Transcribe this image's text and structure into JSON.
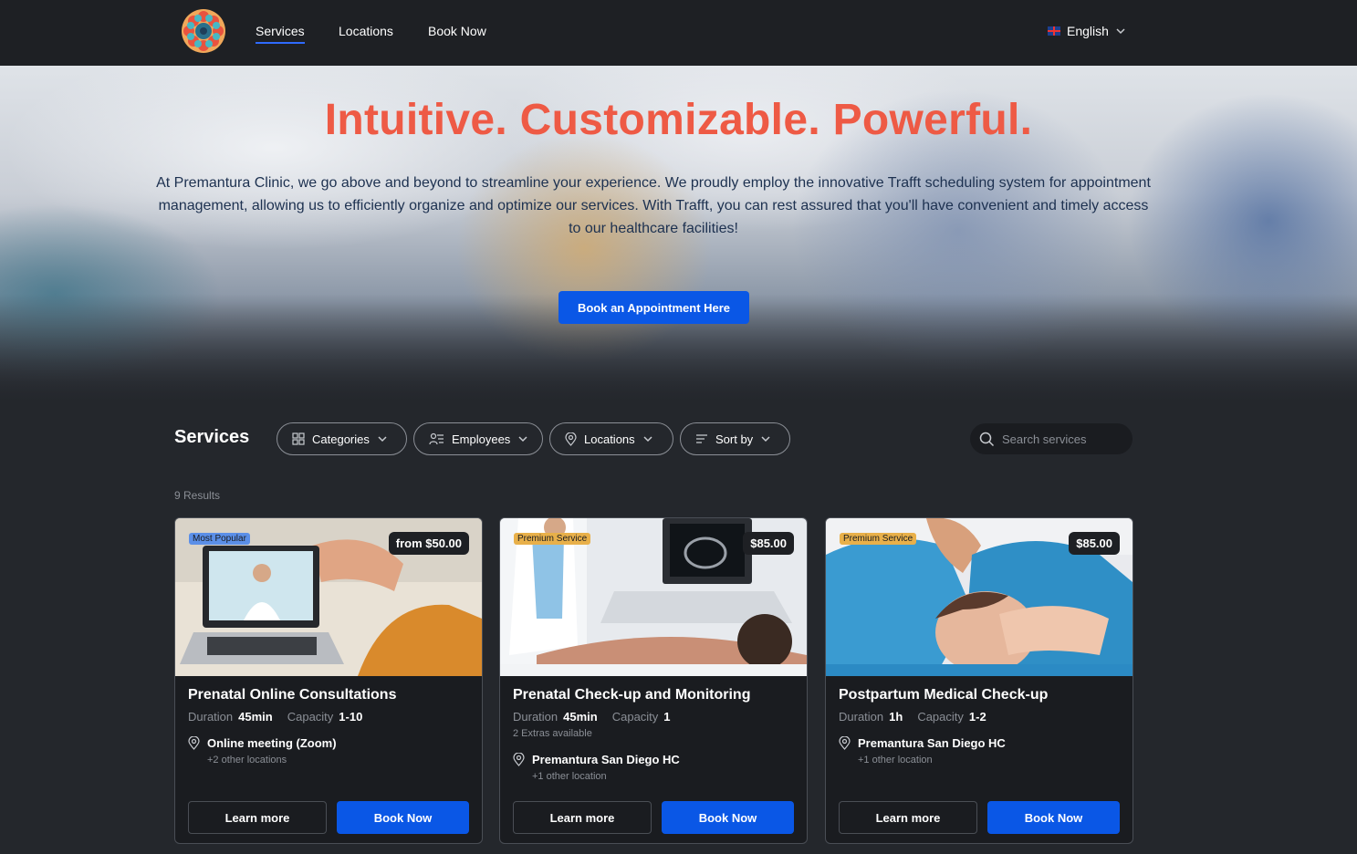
{
  "nav": {
    "links": [
      "Services",
      "Locations",
      "Book Now"
    ],
    "language": "English"
  },
  "hero": {
    "title": "Intuitive. Customizable. Powerful.",
    "text": "At Premantura Clinic, we go above and beyond to streamline your experience. We proudly employ the innovative Trafft scheduling system for appointment management, allowing us to efficiently organize and optimize our services. With Trafft, you can rest assured that you'll have convenient and timely access to our healthcare facilities!",
    "cta": "Book an Appointment Here"
  },
  "services": {
    "title": "Services",
    "filters": [
      "Categories",
      "Employees",
      "Locations",
      "Sort by"
    ],
    "search_placeholder": "Search services",
    "results": "9 Results"
  },
  "cards": [
    {
      "badge": "Most Popular",
      "price": "from $50.00",
      "title": "Prenatal Online Consultations",
      "duration_label": "Duration",
      "duration": "45min",
      "capacity_label": "Capacity",
      "capacity": "1-10",
      "extras": "",
      "location": "Online meeting (Zoom)",
      "location_more": "+2 other locations",
      "learn": "Learn more",
      "book": "Book Now"
    },
    {
      "badge": "Premium Service",
      "price": "$85.00",
      "title": "Prenatal Check-up and Monitoring",
      "duration_label": "Duration",
      "duration": "45min",
      "capacity_label": "Capacity",
      "capacity": "1",
      "extras": "2 Extras available",
      "location": "Premantura San Diego HC",
      "location_more": "+1 other location",
      "learn": "Learn more",
      "book": "Book Now"
    },
    {
      "badge": "Premium Service",
      "price": "$85.00",
      "title": "Postpartum Medical Check-up",
      "duration_label": "Duration",
      "duration": "1h",
      "capacity_label": "Capacity",
      "capacity": "1-2",
      "extras": "",
      "location": "Premantura San Diego HC",
      "location_more": "+1 other location",
      "learn": "Learn more",
      "book": "Book Now"
    }
  ],
  "colors": {
    "accent": "#0a57e6",
    "hero_title": "#ee5a45",
    "badge_popular": "#5b8fe8",
    "badge_premium": "#e8b04a"
  }
}
